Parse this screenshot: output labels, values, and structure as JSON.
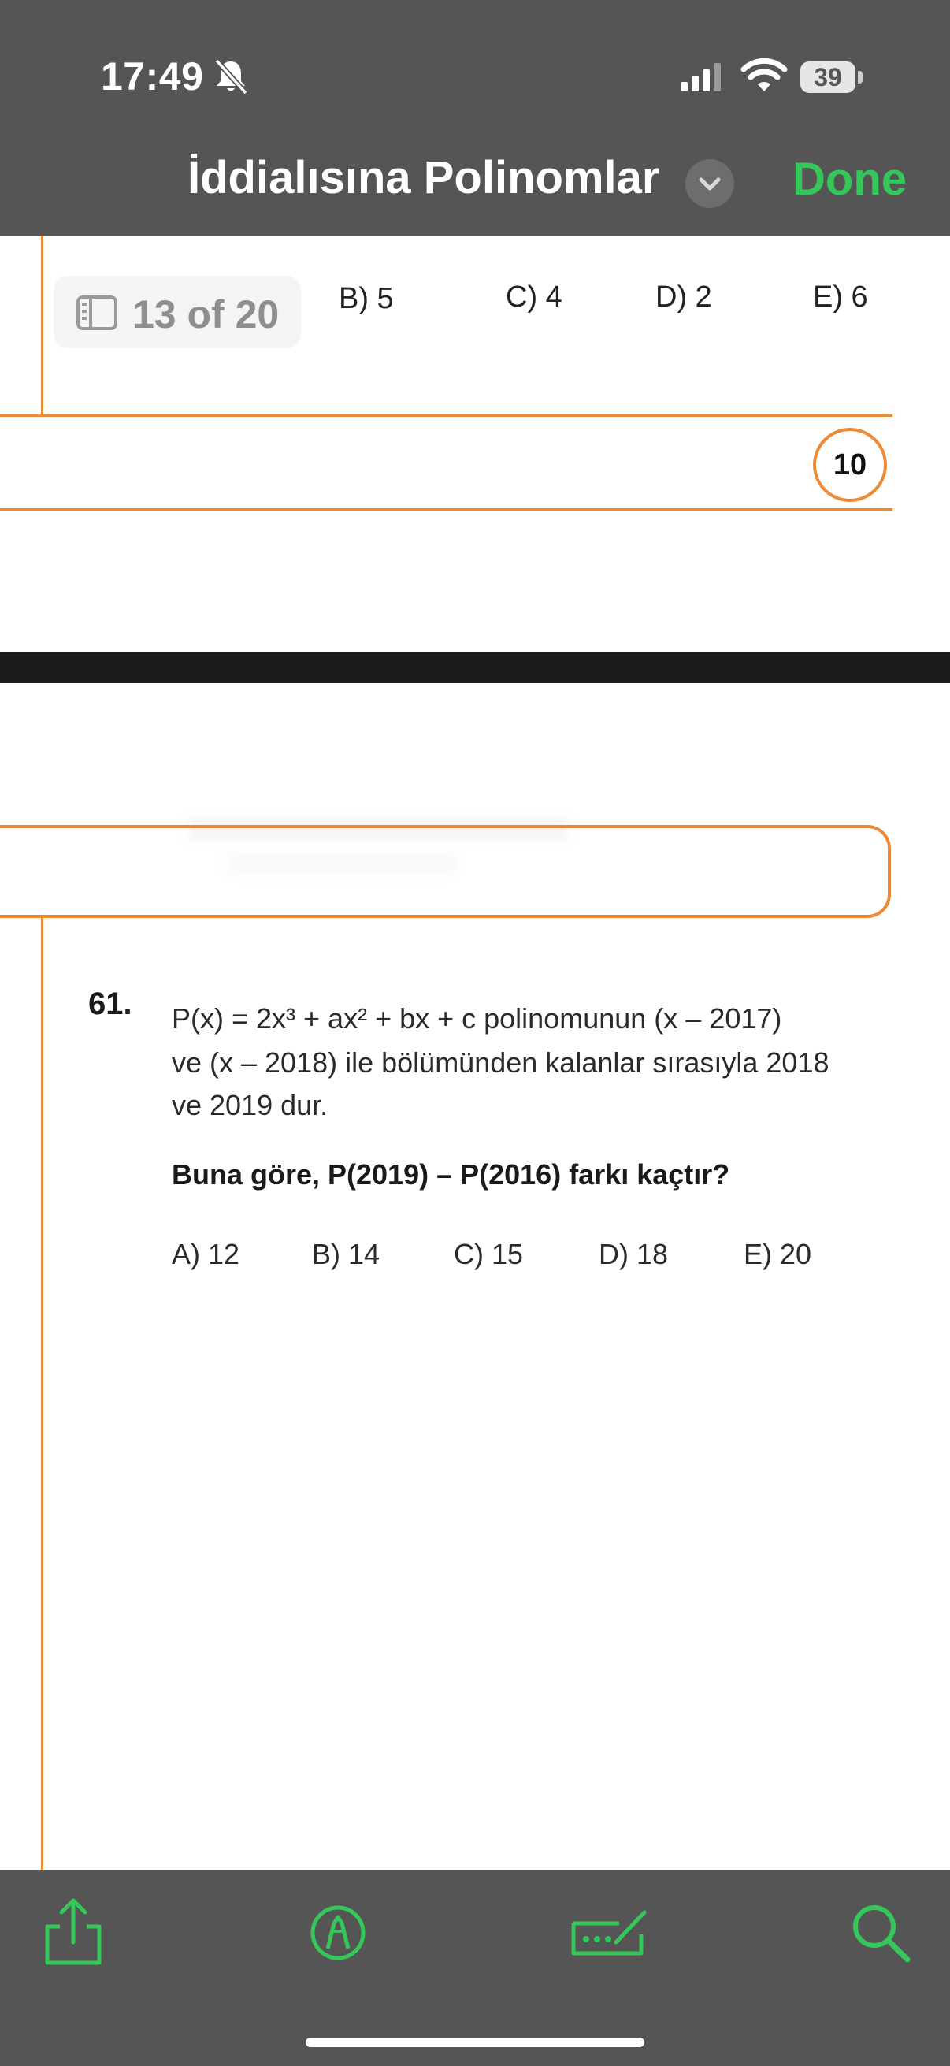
{
  "status_bar": {
    "time": "17:49",
    "battery_level": "39",
    "icons": [
      "bell-slash-icon",
      "cellular-signal-icon",
      "wifi-icon",
      "battery-icon"
    ]
  },
  "nav": {
    "title": "İddialısına Polinomlar",
    "done_label": "Done",
    "chevron_icon": "chevron-down-icon"
  },
  "page_indicator": {
    "label": "13 of 20",
    "icon": "sidebar-icon"
  },
  "previous_question": {
    "options": [
      "B) 5",
      "C) 4",
      "D) 2",
      "E) 6"
    ]
  },
  "page_number": "10",
  "question": {
    "number": "61.",
    "line1": "P(x) = 2x³ + ax² + bx + c  polinomunun  (x – 2017)",
    "line2": "ve  (x – 2018)  ile bölümünden kalanlar sırasıyla  2018",
    "line3": "ve  2019 dur.",
    "ask": "Buna göre,  P(2019) – P(2016)  farkı kaçtır?",
    "options": [
      "A) 12",
      "B) 14",
      "C) 15",
      "D) 18",
      "E) 20"
    ]
  },
  "toolbar": {
    "items": [
      "share-icon",
      "markup-icon",
      "signature-icon",
      "search-icon"
    ]
  },
  "colors": {
    "bar_background": "#555555",
    "accent_green": "#35c759",
    "page_border_orange": "#ee8a33"
  }
}
